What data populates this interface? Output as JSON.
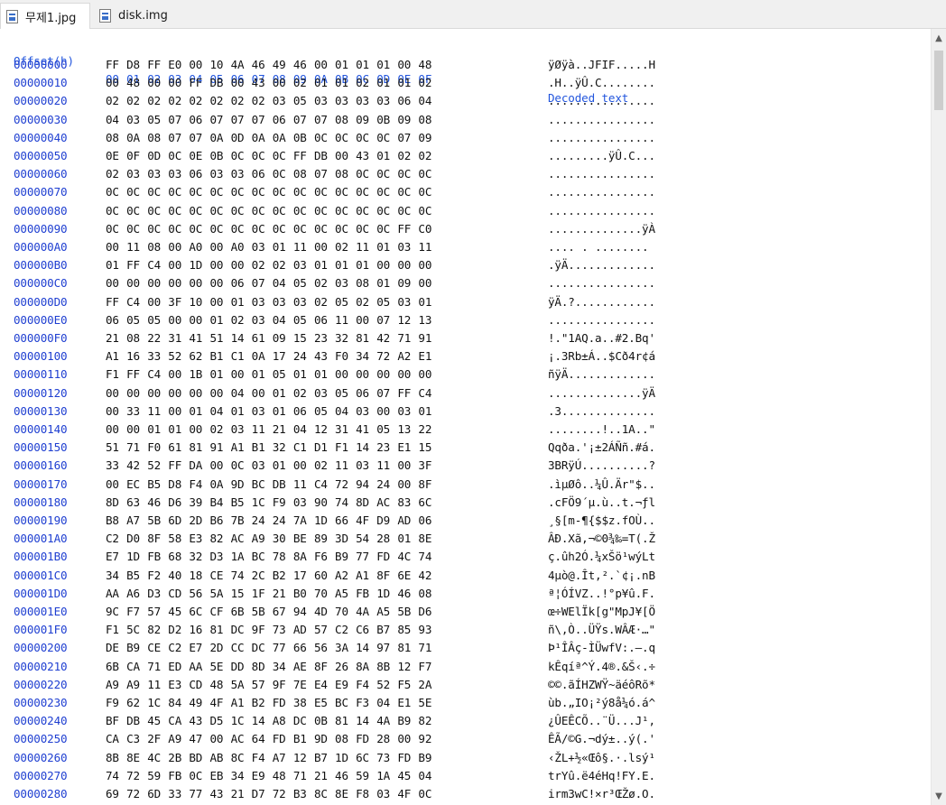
{
  "tabs": [
    {
      "label": "무제1.jpg",
      "icon": "file-icon",
      "active": true
    },
    {
      "label": "disk.img",
      "icon": "file-icon",
      "active": false
    }
  ],
  "header": {
    "offset": "Offset(h)",
    "columns": [
      "00",
      "01",
      "02",
      "03",
      "04",
      "05",
      "06",
      "07",
      "08",
      "09",
      "0A",
      "0B",
      "0C",
      "0D",
      "0E",
      "0F"
    ],
    "decoded": "Decoded text"
  },
  "rows": [
    {
      "offset": "00000000",
      "hex": "FF D8 FF E0 00 10 4A 46 49 46 00 01 01 01 00 48",
      "text": "ÿØÿà..JFIF.....H"
    },
    {
      "offset": "00000010",
      "hex": "00 48 00 00 FF DB 00 43 00 02 01 01 02 01 01 02",
      "text": ".H..ÿÛ.C........"
    },
    {
      "offset": "00000020",
      "hex": "02 02 02 02 02 02 02 02 03 05 03 03 03 03 06 04",
      "text": "................"
    },
    {
      "offset": "00000030",
      "hex": "04 03 05 07 06 07 07 07 06 07 07 08 09 0B 09 08",
      "text": "................"
    },
    {
      "offset": "00000040",
      "hex": "08 0A 08 07 07 0A 0D 0A 0A 0B 0C 0C 0C 0C 07 09",
      "text": "................"
    },
    {
      "offset": "00000050",
      "hex": "0E 0F 0D 0C 0E 0B 0C 0C 0C FF DB 00 43 01 02 02",
      "text": ".........ÿÛ.C..."
    },
    {
      "offset": "00000060",
      "hex": "02 03 03 03 06 03 03 06 0C 08 07 08 0C 0C 0C 0C",
      "text": "................"
    },
    {
      "offset": "00000070",
      "hex": "0C 0C 0C 0C 0C 0C 0C 0C 0C 0C 0C 0C 0C 0C 0C 0C",
      "text": "................"
    },
    {
      "offset": "00000080",
      "hex": "0C 0C 0C 0C 0C 0C 0C 0C 0C 0C 0C 0C 0C 0C 0C 0C",
      "text": "................"
    },
    {
      "offset": "00000090",
      "hex": "0C 0C 0C 0C 0C 0C 0C 0C 0C 0C 0C 0C 0C 0C FF C0",
      "text": "..............ÿÀ"
    },
    {
      "offset": "000000A0",
      "hex": "00 11 08 00 A0 00 A0 03 01 11 00 02 11 01 03 11",
      "text": ".... . ........"
    },
    {
      "offset": "000000B0",
      "hex": "01 FF C4 00 1D 00 00 02 02 03 01 01 01 00 00 00",
      "text": ".ÿÄ............."
    },
    {
      "offset": "000000C0",
      "hex": "00 00 00 00 00 00 06 07 04 05 02 03 08 01 09 00",
      "text": "................"
    },
    {
      "offset": "000000D0",
      "hex": "FF C4 00 3F 10 00 01 03 03 03 02 05 02 05 03 01",
      "text": "ÿÄ.?............"
    },
    {
      "offset": "000000E0",
      "hex": "06 05 05 00 00 01 02 03 04 05 06 11 00 07 12 13",
      "text": "................"
    },
    {
      "offset": "000000F0",
      "hex": "21 08 22 31 41 51 14 61 09 15 23 32 81 42 71 91",
      "text": "!.\"1AQ.a..#2.Bq'"
    },
    {
      "offset": "00000100",
      "hex": "A1 16 33 52 62 B1 C1 0A 17 24 43 F0 34 72 A2 E1",
      "text": "¡.3Rb±Á..$Cð4r¢á"
    },
    {
      "offset": "00000110",
      "hex": "F1 FF C4 00 1B 01 00 01 05 01 01 00 00 00 00 00",
      "text": "ñÿÄ............."
    },
    {
      "offset": "00000120",
      "hex": "00 00 00 00 00 00 04 00 01 02 03 05 06 07 FF C4",
      "text": "..............ÿÄ"
    },
    {
      "offset": "00000130",
      "hex": "00 33 11 00 01 04 01 03 01 06 05 04 03 00 03 01",
      "text": ".3.............."
    },
    {
      "offset": "00000140",
      "hex": "00 00 01 01 00 02 03 11 21 04 12 31 41 05 13 22",
      "text": "........!..1A..\""
    },
    {
      "offset": "00000150",
      "hex": "51 71 F0 61 81 91 A1 B1 32 C1 D1 F1 14 23 E1 15",
      "text": "Qqða.'¡±2ÁÑñ.#á."
    },
    {
      "offset": "00000160",
      "hex": "33 42 52 FF DA 00 0C 03 01 00 02 11 03 11 00 3F",
      "text": "3BRÿÚ..........?"
    },
    {
      "offset": "00000170",
      "hex": "00 EC B5 D8 F4 0A 9D BC DB 11 C4 72 94 24 00 8F",
      "text": ".ìµØô..¼Û.Är\"$.."
    },
    {
      "offset": "00000180",
      "hex": "8D 63 46 D6 39 B4 B5 1C F9 03 90 74 8D AC 83 6C",
      "text": ".cFÖ9´µ.ù..t.¬ƒl"
    },
    {
      "offset": "00000190",
      "hex": "B8 A7 5B 6D 2D B6 7B 24 24 7A 1D 66 4F D9 AD 06",
      "text": "¸§[m-¶{$$z.fOÙ.."
    },
    {
      "offset": "000001A0",
      "hex": "C2 D0 8F 58 E3 82 AC A9 30 BE 89 3D 54 28 01 8E",
      "text": "ÂÐ.Xã‚¬©0¾‰=T(.Ž"
    },
    {
      "offset": "000001B0",
      "hex": "E7 1D FB 68 32 D3 1A BC 78 8A F6 B9 77 FD 4C 74",
      "text": "ç.ûh2Ó.¼xŠö¹wýLt"
    },
    {
      "offset": "000001C0",
      "hex": "34 B5 F2 40 18 CE 74 2C B2 17 60 A2 A1 8F 6E 42",
      "text": "4µò@.Ît,².`¢¡.nB"
    },
    {
      "offset": "000001D0",
      "hex": "AA A6 D3 CD 56 5A 15 1F 21 B0 70 A5 FB 1D 46 08",
      "text": "ª¦ÓÍVZ..!°p¥û.F."
    },
    {
      "offset": "000001E0",
      "hex": "9C F7 57 45 6C CF 6B 5B 67 94 4D 70 4A A5 5B D6",
      "text": "œ÷WElÏk[g\"MpJ¥[Ö"
    },
    {
      "offset": "000001F0",
      "hex": "F1 5C 82 D2 16 81 DC 9F 73 AD 57 C2 C6 B7 85 93",
      "text": "ñ\\‚Ò..ÜŸs.WÂÆ·…\""
    },
    {
      "offset": "00000200",
      "hex": "DE B9 CE C2 E7 2D CC DC 77 66 56 3A 14 97 81 71",
      "text": "Þ¹ÎÂç-ÌÜwfV:.—.q"
    },
    {
      "offset": "00000210",
      "hex": "6B CA 71 ED AA 5E DD 8D 34 AE 8F 26 8A 8B 12 F7",
      "text": "kÊqíª^Ý.4®.&Š‹.÷"
    },
    {
      "offset": "00000220",
      "hex": "A9 A9 11 E3 CD 48 5A 57 9F 7E E4 E9 F4 52 F5 2A",
      "text": "©©.ãÍHZWŸ~äéôRõ*"
    },
    {
      "offset": "00000230",
      "hex": "F9 62 1C 84 49 4F A1 B2 FD 38 E5 BC F3 04 E1 5E",
      "text": "ùb.„IO¡²ý8å¼ó.á^"
    },
    {
      "offset": "00000240",
      "hex": "BF DB 45 CA 43 D5 1C 14 A8 DC 0B 81 14 4A B9 82",
      "text": "¿ÛEÊCÕ..¨Ü...J¹‚"
    },
    {
      "offset": "00000250",
      "hex": "CA C3 2F A9 47 00 AC 64 FD B1 9D 08 FD 28 00 92",
      "text": "ÊÃ/©G.¬dý±..ý(.'"
    },
    {
      "offset": "00000260",
      "hex": "8B 8E 4C 2B BD AB 8C F4 A7 12 B7 1D 6C 73 FD B9",
      "text": "‹ŽL+½«Œô§.·.lsý¹"
    },
    {
      "offset": "00000270",
      "hex": "74 72 59 FB 0C EB 34 E9 48 71 21 46 59 1A 45 04",
      "text": "trYû.ë4éHq!FY.E."
    },
    {
      "offset": "00000280",
      "hex": "69 72 6D 33 77 43 21 D7 72 B3 8C 8E F8 03 4F 0C",
      "text": "irm3wC!×r³ŒŽø.O."
    }
  ],
  "scrollbar": {
    "up_icon": "chevron-up-icon",
    "down_icon": "chevron-down-icon",
    "position": 0
  }
}
